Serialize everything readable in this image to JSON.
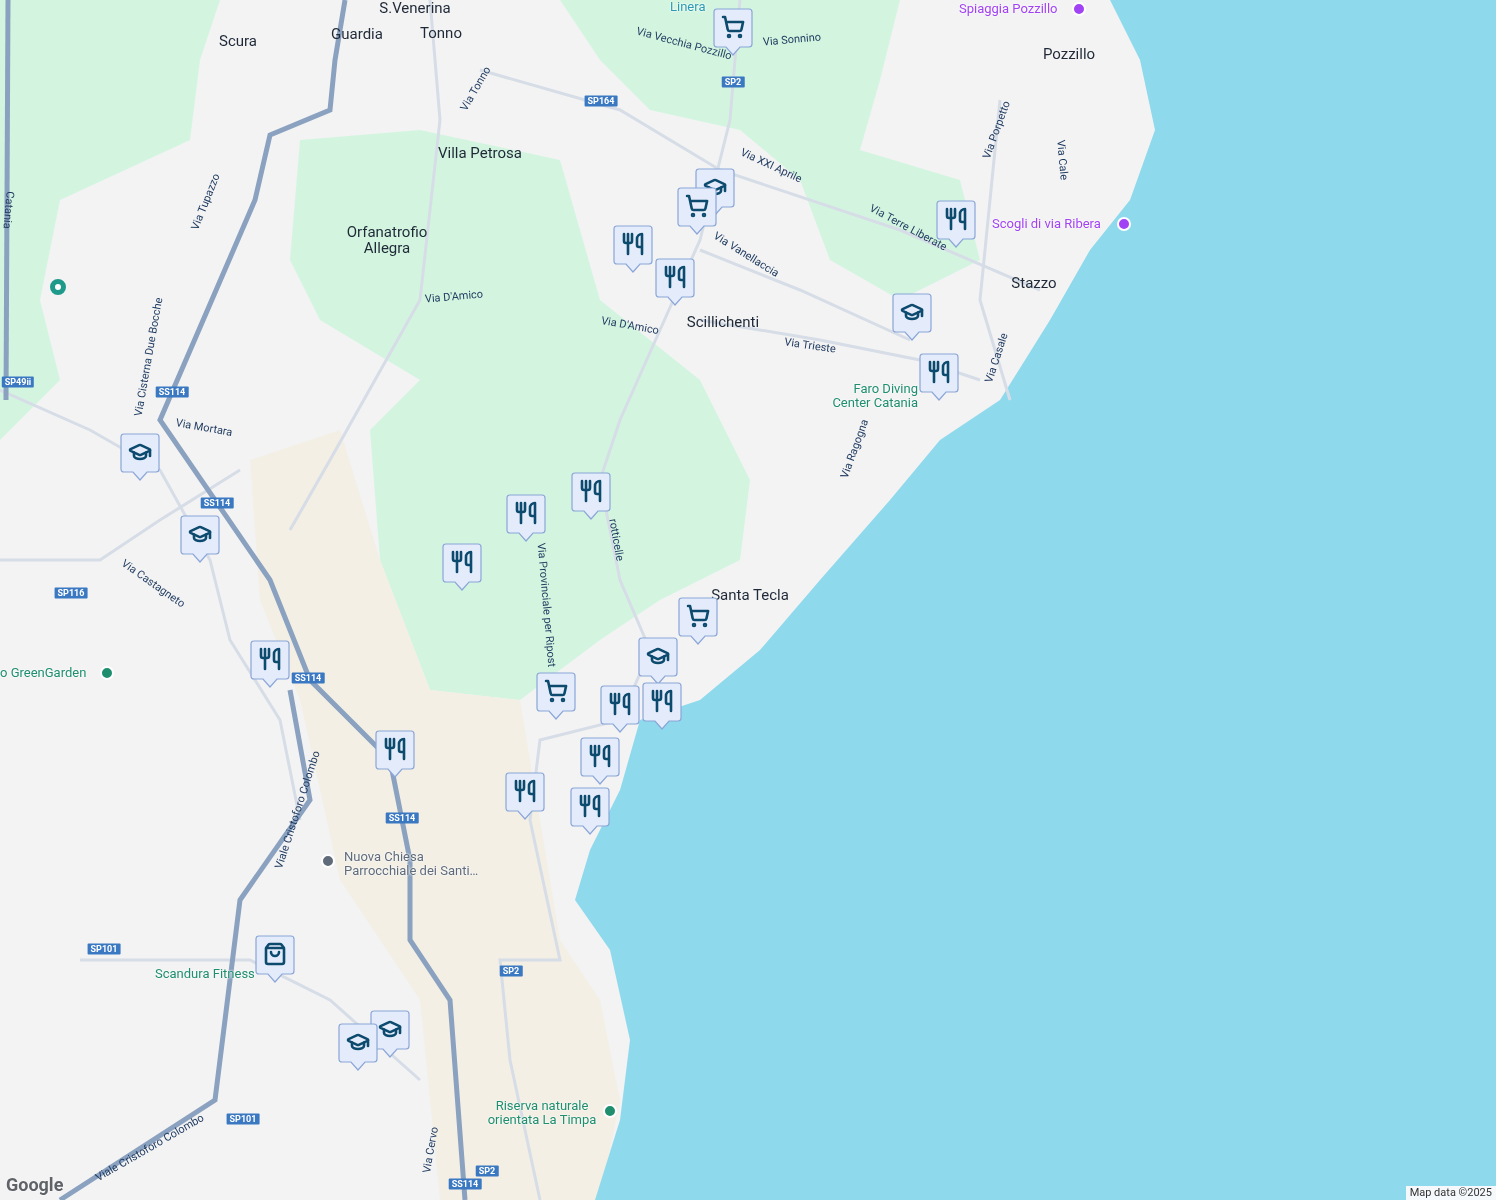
{
  "towns": [
    {
      "name": "S.Venerina"
    },
    {
      "name": "Scura"
    },
    {
      "name": "Guardia"
    },
    {
      "name": "Tonno"
    },
    {
      "name": "Villa Petrosa"
    },
    {
      "name": "Orfanatrofio Allegra"
    },
    {
      "name": "Pozzillo"
    },
    {
      "name": "Scillichenti"
    },
    {
      "name": "Stazzo"
    },
    {
      "name": "Santa Tecla"
    }
  ],
  "pois": [
    {
      "name": "Spiaggia Pozzillo",
      "color": "#a142f4"
    },
    {
      "name": "Scogli di via Ribera",
      "color": "#a142f4"
    },
    {
      "name": "Faro Diving Center Catania",
      "color": "#1e8e6e"
    },
    {
      "name": "o GreenGarden",
      "color": "#1e8e6e"
    },
    {
      "name": "Nuova Chiesa Parrocchiale dei Santi…",
      "color": "#5f6b7a"
    },
    {
      "name": "Scandura Fitness",
      "color": "#1e8e6e"
    },
    {
      "name": "Riserva naturale orientata La Timpa",
      "color": "#1e8e6e"
    },
    {
      "name": "Linera",
      "color": "#2a9ab0"
    }
  ],
  "streets": [
    {
      "name": "Via Vecchia Pozzillo"
    },
    {
      "name": "Via Sonnino"
    },
    {
      "name": "Via Tonno"
    },
    {
      "name": "Via Tupazzo"
    },
    {
      "name": "Via XXI Aprile"
    },
    {
      "name": "Via Terre Liberate"
    },
    {
      "name": "Via Vanellaccia"
    },
    {
      "name": "Via D'Amico"
    },
    {
      "name": "Via D'Amico"
    },
    {
      "name": "Via Trieste"
    },
    {
      "name": "Via Porpetto"
    },
    {
      "name": "Via Cale"
    },
    {
      "name": "Via Casale"
    },
    {
      "name": "Via Cisterna Due Bocche"
    },
    {
      "name": "Via Mortara"
    },
    {
      "name": "Via Ragogna"
    },
    {
      "name": "Via Castagneto"
    },
    {
      "name": "Via Provinciale per Ripost"
    },
    {
      "name": "rotticelle"
    },
    {
      "name": "Viale Cristoforo Colombo"
    },
    {
      "name": "Viale Cristoforo Colombo"
    },
    {
      "name": "Via Cervo"
    },
    {
      "name": "Catania"
    }
  ],
  "shields": [
    {
      "label": "SP164"
    },
    {
      "label": "SP2"
    },
    {
      "label": "SS114"
    },
    {
      "label": "SP49ii"
    },
    {
      "label": "SS114"
    },
    {
      "label": "SP116"
    },
    {
      "label": "SS114"
    },
    {
      "label": "SS114"
    },
    {
      "label": "SP101"
    },
    {
      "label": "SP101"
    },
    {
      "label": "SP2"
    },
    {
      "label": "SP2"
    },
    {
      "label": "SS114"
    }
  ],
  "markers": [
    {
      "kind": "shop"
    },
    {
      "kind": "school"
    },
    {
      "kind": "shop"
    },
    {
      "kind": "restaurant"
    },
    {
      "kind": "restaurant"
    },
    {
      "kind": "restaurant"
    },
    {
      "kind": "school"
    },
    {
      "kind": "restaurant"
    },
    {
      "kind": "school"
    },
    {
      "kind": "school"
    },
    {
      "kind": "restaurant"
    },
    {
      "kind": "restaurant"
    },
    {
      "kind": "restaurant"
    },
    {
      "kind": "shop"
    },
    {
      "kind": "school"
    },
    {
      "kind": "restaurant"
    },
    {
      "kind": "restaurant"
    },
    {
      "kind": "shop"
    },
    {
      "kind": "restaurant"
    },
    {
      "kind": "restaurant"
    },
    {
      "kind": "restaurant"
    },
    {
      "kind": "restaurant"
    },
    {
      "kind": "restaurant"
    },
    {
      "kind": "bag"
    },
    {
      "kind": "school"
    },
    {
      "kind": "school"
    }
  ],
  "logo": "Google",
  "attribution": "Map data ©2025"
}
